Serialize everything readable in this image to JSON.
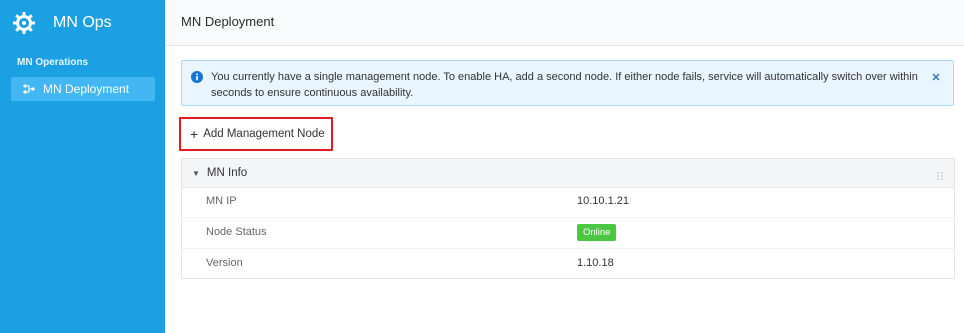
{
  "sidebar": {
    "brand_icon": "gear-wrench-icon",
    "brand_title": "MN Ops",
    "section_label": "MN Operations",
    "items": [
      {
        "label": "MN Deployment",
        "icon": "topology-icon",
        "active": true
      }
    ]
  },
  "header": {
    "title": "MN Deployment"
  },
  "alert": {
    "icon": "info-icon",
    "text": "You currently have a single management node. To enable HA, add a second node. If either node fails, service will automatically switch over within seconds to ensure continuous availability.",
    "close_icon": "close-icon"
  },
  "actions": {
    "add_label": "Add Management Node",
    "add_icon": "plus-icon"
  },
  "panel": {
    "title": "MN Info",
    "rows": [
      {
        "key": "MN IP",
        "value": "10.10.1.21"
      },
      {
        "key": "Node Status",
        "value": "Online"
      },
      {
        "key": "Version",
        "value": "1.10.18"
      }
    ]
  },
  "colors": {
    "sidebar_bg": "#1aa0e3",
    "active_item_bg": "#42b7f2",
    "alert_bg": "#e9f5ff",
    "alert_border": "#a9d8fb",
    "status_online": "#4cc743",
    "highlight_border": "#e21b22"
  }
}
